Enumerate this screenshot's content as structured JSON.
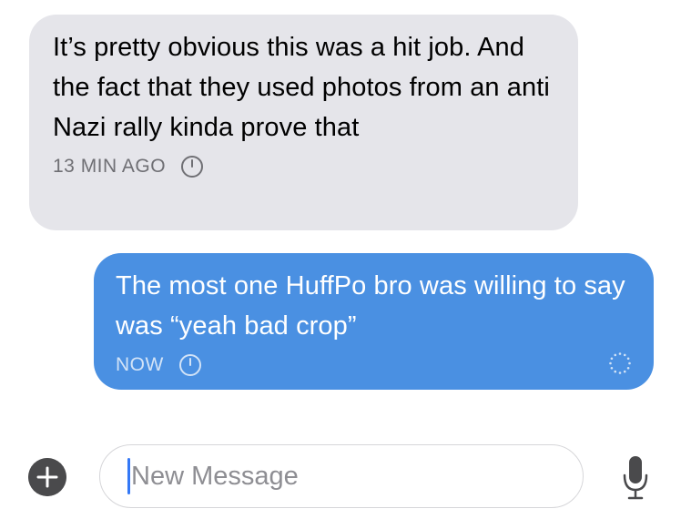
{
  "messages": [
    {
      "direction": "incoming",
      "text": "It’s pretty obvious this was a hit job. And the fact that they used photos from an anti Nazi rally kinda prove that",
      "timestamp": "13 MIN AGO",
      "status_icon": "timer-icon"
    },
    {
      "direction": "outgoing",
      "text": "The most one HuffPo bro was willing to say was “yeah bad crop”",
      "timestamp": "NOW",
      "status_icon": "timer-icon",
      "send_status_icon": "sending-spinner-icon"
    }
  ],
  "composer": {
    "add_icon": "plus-icon",
    "placeholder": "New Message",
    "mic_icon": "microphone-icon"
  },
  "colors": {
    "incoming_bubble": "#e5e5ea",
    "outgoing_bubble": "#4a90e2",
    "caret": "#3478f6"
  }
}
